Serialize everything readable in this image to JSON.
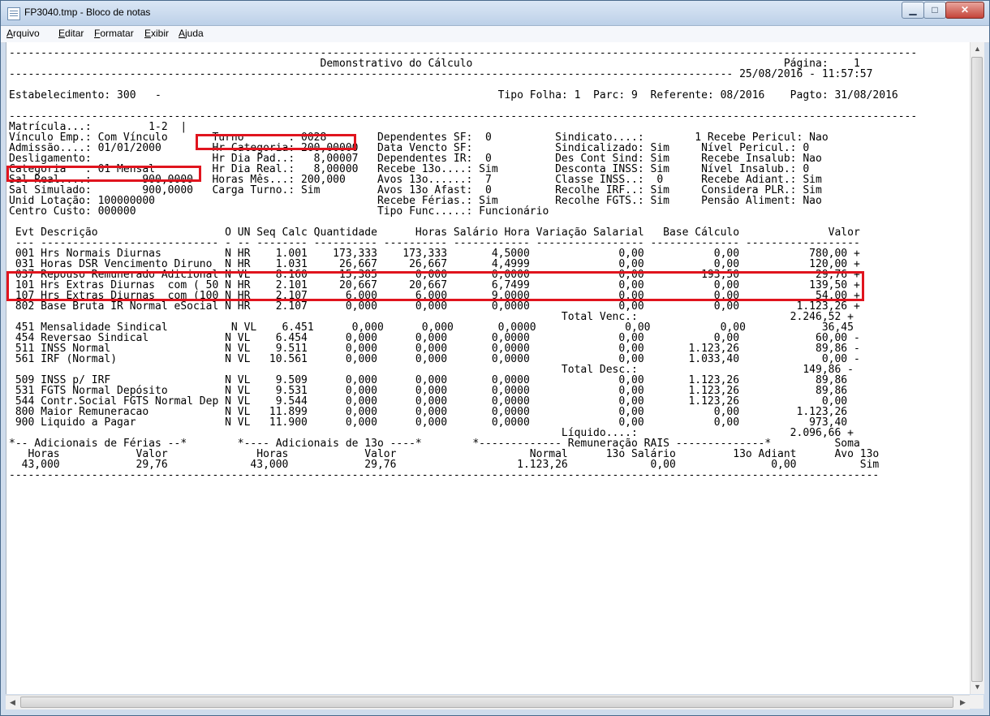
{
  "window": {
    "title": "FP3040.tmp - Bloco de notas",
    "minimize_glyph": "▁",
    "maximize_glyph": "□",
    "close_glyph": "✕"
  },
  "menu": [
    "Arquivo",
    "Editar",
    "Formatar",
    "Exibir",
    "Ajuda"
  ],
  "icons": {
    "app": "notepad-icon"
  },
  "highlight_color": "#e0141e",
  "document": {
    "lines": [
      "-----------------------------------------------------------------------------------------------------------------------------------------------",
      "                                                 Demonstrativo do Cálculo                                                 Página:    1",
      "------------------------------------------------------------------------------------------------------------------ 25/08/2016 - 11:57:57",
      "",
      "Estabelecimento: 300   -                                                     Tipo Folha: 1  Parc: 9  Referente: 08/2016    Pagto: 31/08/2016",
      "",
      "-----------------------------------------------------------------------------------------------------------------------------------------------",
      "Matrícula...:         1-2  |",
      "Vínculo Emp.: Com Vínculo       Turno       : 0028        Dependentes SF:  0          Sindicato....:        1 Recebe Pericul: Nao",
      "Admissão....: 01/01/2000        Hr Categoria: 200,00000   Data Vencto SF:             Sindicalizado: Sim     Nível Pericul.: 0",
      "Desligamento:                   Hr Dia Pad..:   8,00007   Dependentes IR:  0          Des Cont Sind: Sim     Recebe Insalub: Nao",
      "Categoria   : 01 Mensal         Hr Dia Real.:   8,00000   Recebe 13o....: Sim         Desconta INSS: Sim     Nível Insalub.: 0",
      "Sal Real....:        900,0000   Horas Mês...: 200,000     Avos 13o......:  7          Classe INSS..:  0      Recebe Adiant.: Sim",
      "Sal Simulado:        900,0000   Carga Turno.: Sim         Avos 13o Afast:  0          Recolhe IRF..: Sim     Considera PLR.: Sim",
      "Unid Lotação: 100000000                                   Recebe Férias.: Sim         Recolhe FGTS.: Sim     Pensão Aliment: Nao",
      "Centro Custo: 000000                                      Tipo Func.....: Funcionário",
      "",
      " Evt Descrição                    O UN Seq Calc Quantidade      Horas Salário Hora Variação Salarial   Base Cálculo              Valor",
      " --- ---------------------------- - -- -------- ---------- ---------- ------------ ----------------- -------------- ------------------",
      " 001 Hrs Normais Diurnas          N HR    1.001    173,333    173,333       4,5000              0,00           0,00           780,00 +",
      " 031 Horas DSR Vencimento Diruno  N HR    1.031     26,667     26,667       4,4999              0,00           0,00           120,00 +",
      " 037 Repouso Remunerado Adicional N VL    8.160     15,385      0,000       0,0000              0,00         193,50            29,76 +",
      " 101 Hrs Extras Diurnas  com ( 50 N HR    2.101     20,667     20,667       6,7499              0,00           0,00           139,50 +",
      " 107 Hrs Extras Diurnas  com (100 N HR    2.107      6,000      6,000       9,0000              0,00           0,00            54,00 +",
      " 802 Base Bruta IR Normal eSocial N HR    2.107      0,000      0,000       0,0000              0,00           0,00         1.123,26 +",
      "                                                                                       Total Venc.:                        2.246,52 +",
      " 451 Mensalidade Sindical          N VL    6.451      0,000      0,000       0,0000              0,00           0,00            36,45",
      " 454 Reversao Sindical            N VL    6.454      0,000      0,000       0,0000              0,00           0,00            60,00 -",
      " 511 INSS Normal                  N VL    9.511      0,000      0,000       0,0000              0,00       1.123,26            89,86 -",
      " 561 IRF (Normal)                 N VL   10.561      0,000      0,000       0,0000              0,00       1.033,40             0,00 -",
      "                                                                                       Total Desc.:                          149,86 -",
      " 509 INSS p/ IRF                  N VL    9.509      0,000      0,000       0,0000              0,00       1.123,26            89,86",
      " 531 FGTS Normal Depósito         N VL    9.531      0,000      0,000       0,0000              0,00       1.123,26            89,86",
      " 544 Contr.Social FGTS Normal Dep N VL    9.544      0,000      0,000       0,0000              0,00       1.123,26             0,00",
      " 800 Maior Remuneracao            N VL   11.899      0,000      0,000       0,0000              0,00           0,00         1.123,26",
      " 900 Liquido a Pagar              N VL   11.900      0,000      0,000       0,0000              0,00           0,00           973,40",
      "                                                                                       Líquido....:                        2.096,66 +",
      "*-- Adicionais de Férias --*        *---- Adicionais de 13o ----*        *------------- Remuneração RAIS --------------*          Soma",
      "   Horas            Valor              Horas            Valor                     Normal      13o Salário         13o Adiant      Avo 13o",
      "  43,000            29,76             43,000            29,76                   1.123,26             0,00               0,00          Sim",
      "-----------------------------------------------------------------------------------------------------------------------------------------"
    ]
  }
}
